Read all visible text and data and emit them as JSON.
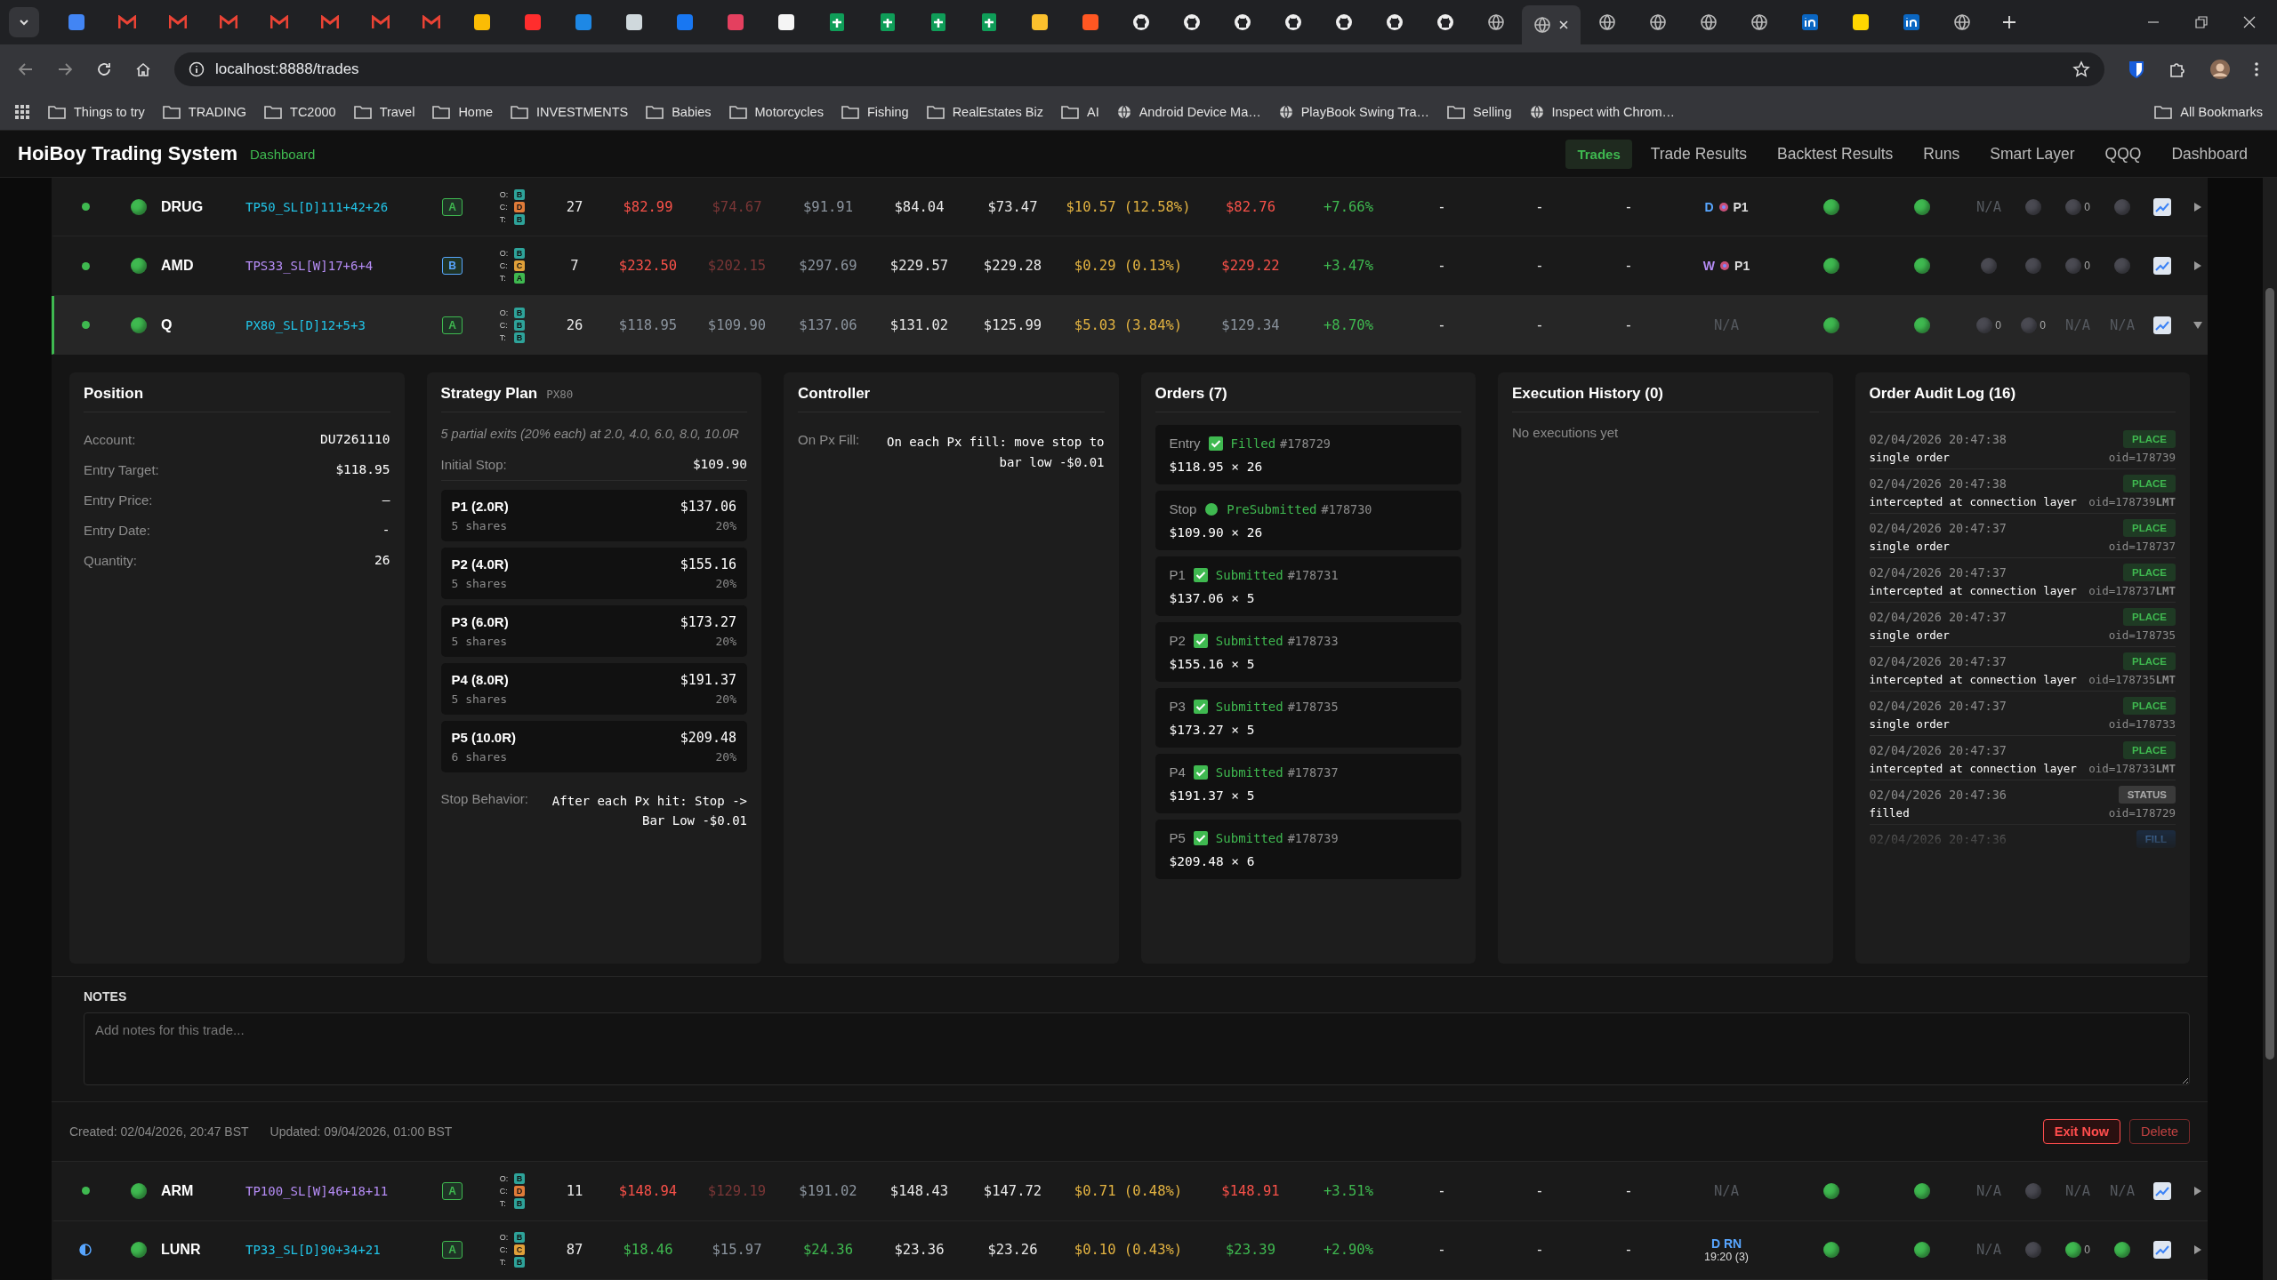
{
  "browser": {
    "tabs": [
      {
        "kind": "app",
        "color": "#4285f4",
        "selected": false
      },
      {
        "kind": "mail",
        "selected": false
      },
      {
        "kind": "mail",
        "selected": false
      },
      {
        "kind": "mail",
        "selected": false
      },
      {
        "kind": "mail",
        "selected": false
      },
      {
        "kind": "mail",
        "selected": false
      },
      {
        "kind": "mail",
        "selected": false
      },
      {
        "kind": "mail",
        "selected": false
      },
      {
        "kind": "app",
        "color": "#fbbc04",
        "selected": false
      },
      {
        "kind": "app",
        "color": "#ff2d2d",
        "selected": false
      },
      {
        "kind": "app",
        "color": "#1e88e5",
        "selected": false
      },
      {
        "kind": "app",
        "color": "#cfd8dc",
        "selected": false
      },
      {
        "kind": "app",
        "color": "#1877f2",
        "selected": false
      },
      {
        "kind": "app",
        "color": "#e4405f",
        "selected": false
      },
      {
        "kind": "app",
        "color": "#f5f5f5",
        "selected": false
      },
      {
        "kind": "sheet",
        "selected": false
      },
      {
        "kind": "sheet",
        "selected": false
      },
      {
        "kind": "sheet",
        "selected": false
      },
      {
        "kind": "sheet",
        "selected": false
      },
      {
        "kind": "app",
        "color": "#fbc02d",
        "selected": false
      },
      {
        "kind": "app",
        "color": "#ff5722",
        "selected": false
      },
      {
        "kind": "github",
        "selected": false
      },
      {
        "kind": "github",
        "selected": false
      },
      {
        "kind": "github",
        "selected": false
      },
      {
        "kind": "github",
        "selected": false
      },
      {
        "kind": "github",
        "selected": false
      },
      {
        "kind": "github",
        "selected": false
      },
      {
        "kind": "github",
        "selected": false
      },
      {
        "kind": "globe",
        "selected": false
      },
      {
        "kind": "globe",
        "selected": true
      },
      {
        "kind": "globe",
        "selected": false
      },
      {
        "kind": "globe",
        "selected": false
      },
      {
        "kind": "globe",
        "selected": false
      },
      {
        "kind": "globe",
        "selected": false
      },
      {
        "kind": "linkedin",
        "selected": false
      },
      {
        "kind": "app",
        "color": "#ffd600",
        "selected": false
      },
      {
        "kind": "linkedin",
        "selected": false
      },
      {
        "kind": "globe",
        "selected": false
      }
    ],
    "address": "localhost:8888/trades",
    "bookmarks": [
      {
        "label": "Things to try",
        "kind": "folder"
      },
      {
        "label": "TRADING",
        "kind": "folder"
      },
      {
        "label": "TC2000",
        "kind": "folder"
      },
      {
        "label": "Travel",
        "kind": "folder"
      },
      {
        "label": "Home",
        "kind": "folder"
      },
      {
        "label": "INVESTMENTS",
        "kind": "folder"
      },
      {
        "label": "Babies",
        "kind": "folder"
      },
      {
        "label": "Motorcycles",
        "kind": "folder"
      },
      {
        "label": "Fishing",
        "kind": "folder"
      },
      {
        "label": "RealEstates Biz",
        "kind": "folder"
      },
      {
        "label": "AI",
        "kind": "folder"
      },
      {
        "label": "Android Device Ma…",
        "kind": "site"
      },
      {
        "label": "PlayBook Swing Tra…",
        "kind": "site"
      },
      {
        "label": "Selling",
        "kind": "folder"
      },
      {
        "label": "Inspect with Chrom…",
        "kind": "site"
      }
    ],
    "all_bookmarks": "All Bookmarks"
  },
  "app": {
    "title": "HoiBoy Trading System",
    "subtitle": "Dashboard",
    "nav": [
      {
        "label": "Trades",
        "selected": true
      },
      {
        "label": "Trade Results",
        "selected": false
      },
      {
        "label": "Backtest Results",
        "selected": false
      },
      {
        "label": "Runs",
        "selected": false
      },
      {
        "label": "Smart Layer",
        "selected": false
      },
      {
        "label": "QQQ",
        "selected": false
      },
      {
        "label": "Dashboard",
        "selected": false
      }
    ]
  },
  "rows_above": [
    {
      "selected": false,
      "cells": [
        {
          "kind": "status",
          "color": "#3fb950"
        },
        {
          "kind": "ball",
          "color": "#3fb950"
        },
        {
          "kind": "ticker",
          "text": "DRUG"
        },
        {
          "kind": "strategy",
          "text": "TP50_SL[D]111+42+26",
          "color": "#22c3e6"
        },
        {
          "kind": "grade",
          "text": "A",
          "color": "#3fb950"
        },
        {
          "kind": "oct",
          "items": [
            {
              "label": "O:",
              "value": "B",
              "color": "#2ea39a"
            },
            {
              "label": "C:",
              "value": "D",
              "color": "#e07b39"
            },
            {
              "label": "T:",
              "value": "B",
              "color": "#2ea39a"
            }
          ]
        },
        {
          "kind": "text",
          "text": "27",
          "color": "#e8e8e8"
        },
        {
          "kind": "text",
          "text": "$82.99",
          "color": "#f85149"
        },
        {
          "kind": "text",
          "text": "$74.67",
          "color": "#7a3636"
        },
        {
          "kind": "text",
          "text": "$91.91",
          "color": "#8b949e"
        },
        {
          "kind": "text",
          "text": "$84.04",
          "color": "#e8e8e8"
        },
        {
          "kind": "text",
          "text": "$73.47",
          "color": "#e8e8e8"
        },
        {
          "kind": "text",
          "text": "$10.57 (12.58%)",
          "color": "#e3b341"
        },
        {
          "kind": "text",
          "text": "$82.76",
          "color": "#f85149"
        },
        {
          "kind": "text",
          "text": "+7.66%",
          "color": "#3fb950"
        },
        {
          "kind": "text",
          "text": "-",
          "color": "#e8e8e8"
        },
        {
          "kind": "text",
          "text": "-",
          "color": "#e8e8e8"
        },
        {
          "kind": "text",
          "text": "-",
          "color": "#e8e8e8"
        },
        {
          "kind": "signal",
          "letter": "D",
          "color": "#58a6ff",
          "label": "P1"
        },
        {
          "kind": "ball",
          "color": "#3fb950"
        },
        {
          "kind": "ball",
          "color": "#3fb950"
        },
        {
          "kind": "text",
          "text": "N/A",
          "color": "#55595f"
        },
        {
          "kind": "ball",
          "color": "#4a4a52"
        },
        {
          "kind": "ball",
          "color": "#4a4a52",
          "count": "0"
        },
        {
          "kind": "ball",
          "color": "#4a4a52"
        },
        {
          "kind": "chart"
        },
        {
          "kind": "toggle",
          "expanded": false
        }
      ]
    },
    {
      "selected": false,
      "cells": [
        {
          "kind": "status",
          "color": "#3fb950"
        },
        {
          "kind": "ball",
          "color": "#3fb950"
        },
        {
          "kind": "ticker",
          "text": "AMD"
        },
        {
          "kind": "strategy",
          "text": "TPS33_SL[W]17+6+4",
          "color": "#b58cf5"
        },
        {
          "kind": "grade",
          "text": "B",
          "color": "#58a6ff"
        },
        {
          "kind": "oct",
          "items": [
            {
              "label": "O:",
              "value": "B",
              "color": "#2ea39a"
            },
            {
              "label": "C:",
              "value": "C",
              "color": "#e0a039"
            },
            {
              "label": "T:",
              "value": "A",
              "color": "#3fb950"
            }
          ]
        },
        {
          "kind": "text",
          "text": "7",
          "color": "#e8e8e8"
        },
        {
          "kind": "text",
          "text": "$232.50",
          "color": "#f85149"
        },
        {
          "kind": "text",
          "text": "$202.15",
          "color": "#7a3636"
        },
        {
          "kind": "text",
          "text": "$297.69",
          "color": "#8b949e"
        },
        {
          "kind": "text",
          "text": "$229.57",
          "color": "#e8e8e8"
        },
        {
          "kind": "text",
          "text": "$229.28",
          "color": "#e8e8e8"
        },
        {
          "kind": "text",
          "text": "$0.29 (0.13%)",
          "color": "#e3b341"
        },
        {
          "kind": "text",
          "text": "$229.22",
          "color": "#f85149"
        },
        {
          "kind": "text",
          "text": "+3.47%",
          "color": "#3fb950"
        },
        {
          "kind": "text",
          "text": "-",
          "color": "#e8e8e8"
        },
        {
          "kind": "text",
          "text": "-",
          "color": "#e8e8e8"
        },
        {
          "kind": "text",
          "text": "-",
          "color": "#e8e8e8"
        },
        {
          "kind": "signal",
          "letter": "W",
          "color": "#b58cf5",
          "label": "P1"
        },
        {
          "kind": "ball",
          "color": "#3fb950"
        },
        {
          "kind": "ball",
          "color": "#3fb950"
        },
        {
          "kind": "ball",
          "color": "#4a4a52"
        },
        {
          "kind": "ball",
          "color": "#4a4a52"
        },
        {
          "kind": "ball",
          "color": "#4a4a52",
          "count": "0"
        },
        {
          "kind": "ball",
          "color": "#4a4a52"
        },
        {
          "kind": "chart"
        },
        {
          "kind": "toggle",
          "expanded": false
        }
      ]
    },
    {
      "selected": true,
      "cells": [
        {
          "kind": "status",
          "color": "#3fb950"
        },
        {
          "kind": "ball",
          "color": "#3fb950"
        },
        {
          "kind": "ticker",
          "text": "Q"
        },
        {
          "kind": "strategy",
          "text": "PX80_SL[D]12+5+3",
          "color": "#22c3e6"
        },
        {
          "kind": "grade",
          "text": "A",
          "color": "#3fb950"
        },
        {
          "kind": "oct",
          "items": [
            {
              "label": "O:",
              "value": "B",
              "color": "#2ea39a"
            },
            {
              "label": "C:",
              "value": "B",
              "color": "#2ea39a"
            },
            {
              "label": "T:",
              "value": "B",
              "color": "#2ea39a"
            }
          ]
        },
        {
          "kind": "text",
          "text": "26",
          "color": "#e8e8e8"
        },
        {
          "kind": "text",
          "text": "$118.95",
          "color": "#8b949e"
        },
        {
          "kind": "text",
          "text": "$109.90",
          "color": "#8b949e"
        },
        {
          "kind": "text",
          "text": "$137.06",
          "color": "#8b949e"
        },
        {
          "kind": "text",
          "text": "$131.02",
          "color": "#e8e8e8"
        },
        {
          "kind": "text",
          "text": "$125.99",
          "color": "#e8e8e8"
        },
        {
          "kind": "text",
          "text": "$5.03 (3.84%)",
          "color": "#e3b341"
        },
        {
          "kind": "text",
          "text": "$129.34",
          "color": "#8b949e"
        },
        {
          "kind": "text",
          "text": "+8.70%",
          "color": "#3fb950"
        },
        {
          "kind": "text",
          "text": "-",
          "color": "#e8e8e8"
        },
        {
          "kind": "text",
          "text": "-",
          "color": "#e8e8e8"
        },
        {
          "kind": "text",
          "text": "-",
          "color": "#e8e8e8"
        },
        {
          "kind": "text",
          "text": "N/A",
          "color": "#55595f"
        },
        {
          "kind": "ball",
          "color": "#3fb950"
        },
        {
          "kind": "ball",
          "color": "#3fb950"
        },
        {
          "kind": "ball",
          "color": "#4a4a52",
          "count": "0"
        },
        {
          "kind": "ball",
          "color": "#4a4a52",
          "count": "0"
        },
        {
          "kind": "text",
          "text": "N/A",
          "color": "#55595f"
        },
        {
          "kind": "text",
          "text": "N/A",
          "color": "#55595f"
        },
        {
          "kind": "chart"
        },
        {
          "kind": "toggle",
          "expanded": true
        }
      ]
    }
  ],
  "detail": {
    "position": {
      "title": "Position",
      "fields": [
        {
          "label": "Account:",
          "value": "DU7261110"
        },
        {
          "label": "Entry Target:",
          "value": "$118.95"
        },
        {
          "label": "Entry Price:",
          "value": "—"
        },
        {
          "label": "Entry Date:",
          "value": "-"
        },
        {
          "label": "Quantity:",
          "value": "26"
        }
      ]
    },
    "strategy": {
      "title": "Strategy Plan",
      "tag": "PX80",
      "description": "5 partial exits (20% each) at 2.0, 4.0, 6.0, 8.0, 10.0R",
      "initial_stop": {
        "label": "Initial Stop:",
        "value": "$109.90"
      },
      "targets": [
        {
          "name": "P1 (2.0R)",
          "price": "$137.06",
          "shares": "5 shares",
          "pct": "20%"
        },
        {
          "name": "P2 (4.0R)",
          "price": "$155.16",
          "shares": "5 shares",
          "pct": "20%"
        },
        {
          "name": "P3 (6.0R)",
          "price": "$173.27",
          "shares": "5 shares",
          "pct": "20%"
        },
        {
          "name": "P4 (8.0R)",
          "price": "$191.37",
          "shares": "5 shares",
          "pct": "20%"
        },
        {
          "name": "P5 (10.0R)",
          "price": "$209.48",
          "shares": "6 shares",
          "pct": "20%"
        }
      ],
      "stop_behavior": {
        "label": "Stop Behavior:",
        "value": "After each Px hit: Stop -> Bar Low -$0.01"
      }
    },
    "controller": {
      "title": "Controller",
      "fields": [
        {
          "label": "On Px Fill:",
          "value": "On each Px fill: move stop to bar low -$0.01"
        }
      ]
    },
    "orders": {
      "title": "Orders (7)",
      "items": [
        {
          "name": "Entry",
          "kind": "check",
          "status": "Filled",
          "id": "#178729",
          "line": "$118.95 × 26"
        },
        {
          "name": "Stop",
          "kind": "dot",
          "status": "PreSubmitted",
          "id": "#178730",
          "line": "$109.90 × 26"
        },
        {
          "name": "P1",
          "kind": "check",
          "status": "Submitted",
          "id": "#178731",
          "line": "$137.06 × 5"
        },
        {
          "name": "P2",
          "kind": "check",
          "status": "Submitted",
          "id": "#178733",
          "line": "$155.16 × 5"
        },
        {
          "name": "P3",
          "kind": "check",
          "status": "Submitted",
          "id": "#178735",
          "line": "$173.27 × 5"
        },
        {
          "name": "P4",
          "kind": "check",
          "status": "Submitted",
          "id": "#178737",
          "line": "$191.37 × 5"
        },
        {
          "name": "P5",
          "kind": "check",
          "status": "Submitted",
          "id": "#178739",
          "line": "$209.48 × 6"
        }
      ]
    },
    "execution": {
      "title": "Execution History (0)",
      "empty": "No executions yet"
    },
    "audit": {
      "title": "Order Audit Log (16)",
      "entries": [
        {
          "time": "02/04/2026 20:47:38",
          "action": "PLACE",
          "kind": "place",
          "note": "single order",
          "oid": "oid=178739"
        },
        {
          "time": "02/04/2026 20:47:38",
          "action": "PLACE",
          "kind": "place",
          "note": "intercepted at connection layer",
          "oid": "oid=178739**LMT**"
        },
        {
          "time": "02/04/2026 20:47:37",
          "action": "PLACE",
          "kind": "place",
          "note": "single order",
          "oid": "oid=178737"
        },
        {
          "time": "02/04/2026 20:47:37",
          "action": "PLACE",
          "kind": "place",
          "note": "intercepted at connection layer",
          "oid": "oid=178737**LMT**"
        },
        {
          "time": "02/04/2026 20:47:37",
          "action": "PLACE",
          "kind": "place",
          "note": "single order",
          "oid": "oid=178735"
        },
        {
          "time": "02/04/2026 20:47:37",
          "action": "PLACE",
          "kind": "place",
          "note": "intercepted at connection layer",
          "oid": "oid=178735**LMT**"
        },
        {
          "time": "02/04/2026 20:47:37",
          "action": "PLACE",
          "kind": "place",
          "note": "single order",
          "oid": "oid=178733"
        },
        {
          "time": "02/04/2026 20:47:37",
          "action": "PLACE",
          "kind": "place",
          "note": "intercepted at connection layer",
          "oid": "oid=178733**LMT**"
        },
        {
          "time": "02/04/2026 20:47:36",
          "action": "STATUS",
          "kind": "status",
          "note": "filled",
          "oid": "oid=178729"
        },
        {
          "time": "02/04/2026 20:47:36",
          "action": "FILL",
          "kind": "fill"
        }
      ]
    },
    "notes": {
      "label": "NOTES",
      "placeholder": "Add notes for this trade..."
    },
    "created": "Created: 02/04/2026, 20:47 BST",
    "updated": "Updated: 09/04/2026, 01:00 BST",
    "buttons": [
      {
        "label": "Exit Now",
        "kind": "danger"
      },
      {
        "label": "Delete",
        "kind": "outline"
      }
    ]
  },
  "rows_below": [
    {
      "selected": false,
      "cells": [
        {
          "kind": "status",
          "color": "#3fb950"
        },
        {
          "kind": "ball",
          "color": "#3fb950"
        },
        {
          "kind": "ticker",
          "text": "ARM"
        },
        {
          "kind": "strategy",
          "text": "TP100_SL[W]46+18+11",
          "color": "#b58cf5"
        },
        {
          "kind": "grade",
          "text": "A",
          "color": "#3fb950"
        },
        {
          "kind": "oct",
          "items": [
            {
              "label": "O:",
              "value": "B",
              "color": "#2ea39a"
            },
            {
              "label": "C:",
              "value": "D",
              "color": "#e07b39"
            },
            {
              "label": "T:",
              "value": "B",
              "color": "#2ea39a"
            }
          ]
        },
        {
          "kind": "text",
          "text": "11",
          "color": "#e8e8e8"
        },
        {
          "kind": "text",
          "text": "$148.94",
          "color": "#f85149"
        },
        {
          "kind": "text",
          "text": "$129.19",
          "color": "#7a3636"
        },
        {
          "kind": "text",
          "text": "$191.02",
          "color": "#8b949e"
        },
        {
          "kind": "text",
          "text": "$148.43",
          "color": "#e8e8e8"
        },
        {
          "kind": "text",
          "text": "$147.72",
          "color": "#e8e8e8"
        },
        {
          "kind": "text",
          "text": "$0.71 (0.48%)",
          "color": "#e3b341"
        },
        {
          "kind": "text",
          "text": "$148.91",
          "color": "#f85149"
        },
        {
          "kind": "text",
          "text": "+3.51%",
          "color": "#3fb950"
        },
        {
          "kind": "text",
          "text": "-",
          "color": "#e8e8e8"
        },
        {
          "kind": "text",
          "text": "-",
          "color": "#e8e8e8"
        },
        {
          "kind": "text",
          "text": "-",
          "color": "#e8e8e8"
        },
        {
          "kind": "text",
          "text": "N/A",
          "color": "#55595f"
        },
        {
          "kind": "ball",
          "color": "#3fb950"
        },
        {
          "kind": "ball",
          "color": "#3fb950"
        },
        {
          "kind": "text",
          "text": "N/A",
          "color": "#55595f"
        },
        {
          "kind": "ball",
          "color": "#4a4a52"
        },
        {
          "kind": "text",
          "text": "N/A",
          "color": "#55595f"
        },
        {
          "kind": "text",
          "text": "N/A",
          "color": "#55595f"
        },
        {
          "kind": "chart"
        },
        {
          "kind": "toggle",
          "expanded": false
        }
      ]
    },
    {
      "selected": false,
      "cells": [
        {
          "kind": "half",
          "color": "#58a6ff"
        },
        {
          "kind": "ball",
          "color": "#3fb950"
        },
        {
          "kind": "ticker",
          "text": "LUNR"
        },
        {
          "kind": "strategy",
          "text": "TP33_SL[D]90+34+21",
          "color": "#22c3e6"
        },
        {
          "kind": "grade",
          "text": "A",
          "color": "#3fb950"
        },
        {
          "kind": "oct",
          "items": [
            {
              "label": "O:",
              "value": "B",
              "color": "#2ea39a"
            },
            {
              "label": "C:",
              "value": "C",
              "color": "#e0a039"
            },
            {
              "label": "T:",
              "value": "B",
              "color": "#2ea39a"
            }
          ]
        },
        {
          "kind": "text",
          "text": "87",
          "color": "#e8e8e8"
        },
        {
          "kind": "text",
          "text": "$18.46",
          "color": "#3fb950"
        },
        {
          "kind": "text",
          "text": "$15.97",
          "color": "#8b949e"
        },
        {
          "kind": "text",
          "text": "$24.36",
          "color": "#3fb950"
        },
        {
          "kind": "text",
          "text": "$23.36",
          "color": "#e8e8e8"
        },
        {
          "kind": "text",
          "text": "$23.26",
          "color": "#e8e8e8"
        },
        {
          "kind": "text",
          "text": "$0.10 (0.43%)",
          "color": "#e3b341"
        },
        {
          "kind": "text",
          "text": "$23.39",
          "color": "#3fb950"
        },
        {
          "kind": "text",
          "text": "+2.90%",
          "color": "#3fb950"
        },
        {
          "kind": "text",
          "text": "-",
          "color": "#e8e8e8"
        },
        {
          "kind": "text",
          "text": "-",
          "color": "#e8e8e8"
        },
        {
          "kind": "text",
          "text": "-",
          "color": "#e8e8e8"
        },
        {
          "kind": "signal2",
          "top": "D RN",
          "bottom": "19:20 (3)"
        },
        {
          "kind": "ball",
          "color": "#3fb950"
        },
        {
          "kind": "ball",
          "color": "#3fb950"
        },
        {
          "kind": "text",
          "text": "N/A",
          "color": "#55595f"
        },
        {
          "kind": "ball",
          "color": "#4a4a52"
        },
        {
          "kind": "ball",
          "color": "#3fb950",
          "count": "0"
        },
        {
          "kind": "ball",
          "color": "#3fb950"
        },
        {
          "kind": "chart"
        },
        {
          "kind": "toggle",
          "expanded": false
        }
      ]
    }
  ]
}
